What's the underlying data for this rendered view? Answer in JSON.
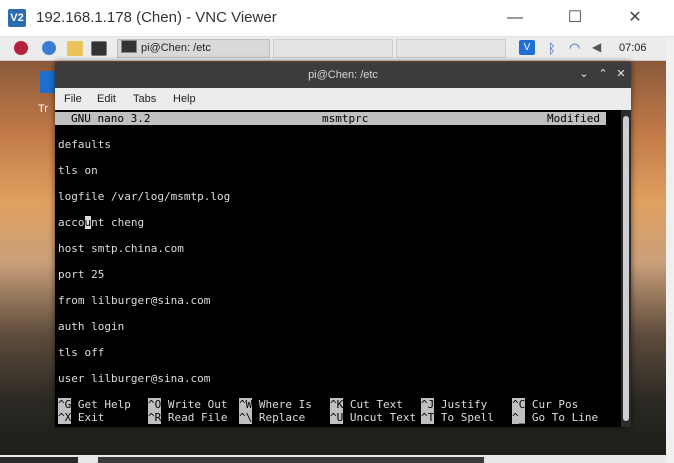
{
  "vnc": {
    "logo": "V2",
    "title": "192.168.1.178 (Chen) - VNC Viewer",
    "controls": {
      "minimize": "—",
      "maximize": "☐",
      "close": "✕"
    }
  },
  "panel": {
    "task_label": "pi@Chen: /etc",
    "clock": "07:06",
    "icons": [
      "raspberry-icon",
      "globe-icon",
      "folder-icon",
      "terminal-icon",
      "vnc-icon",
      "bluetooth-icon",
      "wifi-icon",
      "volume-icon"
    ]
  },
  "desktop": {
    "icon_label": "Tr"
  },
  "terminal": {
    "title": "pi@Chen: /etc",
    "controls": {
      "minimize": "⌄",
      "maximize": "⌃",
      "close": "✕"
    },
    "menu": [
      "File",
      "Edit",
      "Tabs",
      "Help"
    ]
  },
  "nano": {
    "header_left": "GNU nano 3.2",
    "header_center": "msmtprc",
    "header_right": "Modified",
    "lines": [
      "defaults",
      "tls on",
      "logfile /var/log/msmtp.log",
      "account cheng",
      "host smtp.china.com",
      "port 25",
      "from lilburger@sina.com",
      "auth login",
      "tls off",
      "user lilburger@sina.com"
    ],
    "cursor_line_prefix": "acco",
    "cursor_char": "u",
    "cursor_line_suffix": "nt cheng",
    "shortcuts_row1": [
      {
        "key": "^G",
        "label": "Get Help"
      },
      {
        "key": "^O",
        "label": "Write Out"
      },
      {
        "key": "^W",
        "label": "Where Is"
      },
      {
        "key": "^K",
        "label": "Cut Text"
      },
      {
        "key": "^J",
        "label": "Justify"
      },
      {
        "key": "^C",
        "label": "Cur Pos"
      }
    ],
    "shortcuts_row2": [
      {
        "key": "^X",
        "label": "Exit"
      },
      {
        "key": "^R",
        "label": "Read File"
      },
      {
        "key": "^\\",
        "label": "Replace"
      },
      {
        "key": "^U",
        "label": "Uncut Text"
      },
      {
        "key": "^T",
        "label": "To Spell"
      },
      {
        "key": "^_",
        "label": "Go To Line"
      }
    ]
  }
}
